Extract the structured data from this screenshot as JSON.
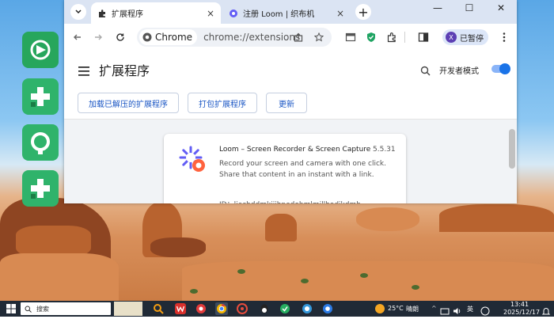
{
  "browser": {
    "tabs": [
      {
        "title": "扩展程序",
        "close": "×"
      },
      {
        "title": "注册 Loom | 织布机",
        "close": "×"
      }
    ],
    "new_tab": "+",
    "window_controls": {
      "minimize": "—",
      "maximize": "☐",
      "close": "✕"
    },
    "omnibox": {
      "chip": "Chrome",
      "url": "chrome://extensions"
    },
    "profile": {
      "initial": "X",
      "label": "已暂停"
    }
  },
  "extensions_page": {
    "title": "扩展程序",
    "developer_mode_label": "开发者模式",
    "developer_mode_on": true,
    "buttons": {
      "load_unpacked": "加载已解压的扩展程序",
      "pack": "打包扩展程序",
      "update": "更新"
    },
    "extension": {
      "name": "Loom – Screen Recorder & Screen Capture",
      "version": "5.5.31",
      "description_line1": "Record your screen and camera with one click.",
      "description_line2": "Share that content in an instant with a link.",
      "id": "ID：liecbddmkiiihnedobmlmillhodjkdmb"
    }
  },
  "taskbar": {
    "search": "搜索",
    "weather_temp": "25°C",
    "weather_desc": "晴朗",
    "ime": "英",
    "time": "13:41",
    "date": "2025/12/17"
  },
  "colors": {
    "accent": "#1a73e8",
    "tab_strip": "#dbe4f3",
    "loom_purple": "#625df5",
    "loom_orange": "#ff623e",
    "desktop_icon_green": "#2fb36b",
    "taskbar": "#202a36"
  }
}
